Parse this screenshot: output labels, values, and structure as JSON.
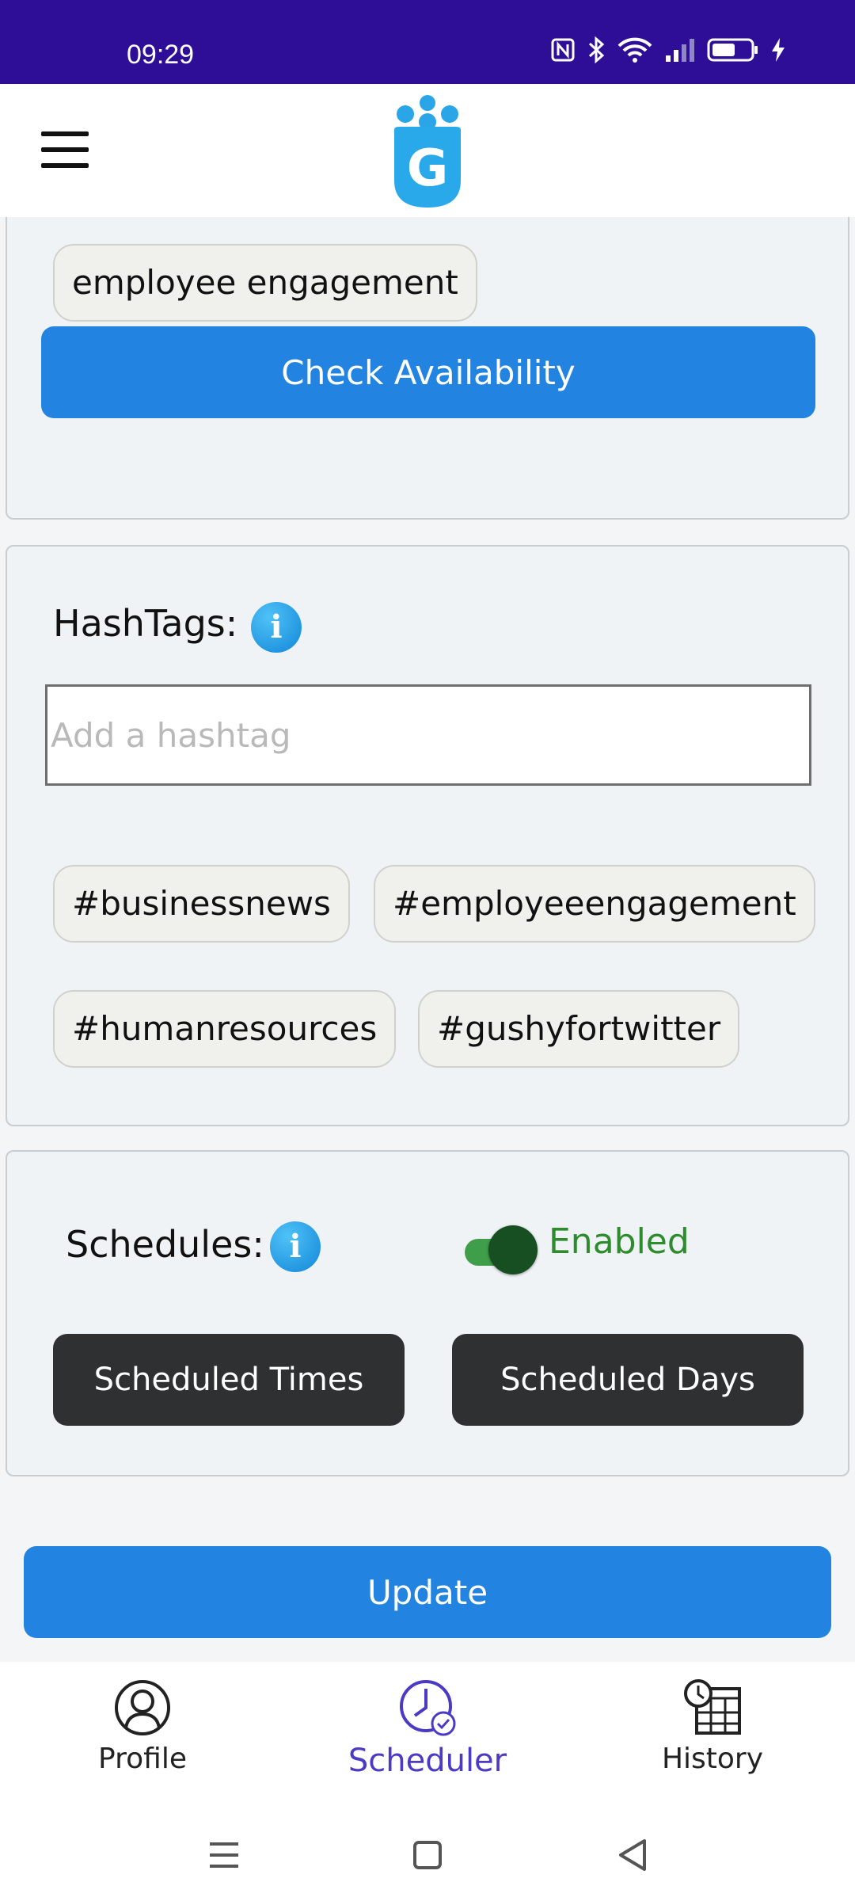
{
  "status_bar": {
    "time": "09:29",
    "icons": [
      "nfc-icon",
      "bluetooth-icon",
      "wifi-icon",
      "signal-icon",
      "battery-icon",
      "charging-icon"
    ]
  },
  "header": {
    "menu_icon": "hamburger-menu-icon",
    "logo_letter": "G"
  },
  "keywords_card": {
    "chip": "employee engagement",
    "check_button": "Check Availability"
  },
  "hashtags_card": {
    "label": "HashTags:",
    "info_glyph": "i",
    "input_placeholder": "Add a hashtag",
    "input_value": "",
    "tags": [
      "#businessnews",
      "#employeeengagement",
      "#humanresources",
      "#gushyfortwitter"
    ]
  },
  "schedules_card": {
    "label": "Schedules:",
    "info_glyph": "i",
    "toggle_enabled": true,
    "toggle_label": "Enabled",
    "times_button": "Scheduled Times",
    "days_button": "Scheduled Days"
  },
  "update_button": "Update",
  "bottom_nav": {
    "items": [
      {
        "label": "Profile",
        "icon": "profile-icon",
        "active": false
      },
      {
        "label": "Scheduler",
        "icon": "scheduler-clock-icon",
        "active": true
      },
      {
        "label": "History",
        "icon": "history-calendar-icon",
        "active": false
      }
    ]
  },
  "colors": {
    "status_bar": "#2e0e97",
    "primary_blue": "#2284e0",
    "dark_button": "#2e3032",
    "enabled_green": "#2e8b2e",
    "active_nav": "#4b3ac4",
    "logo_blue": "#29a8ea"
  }
}
